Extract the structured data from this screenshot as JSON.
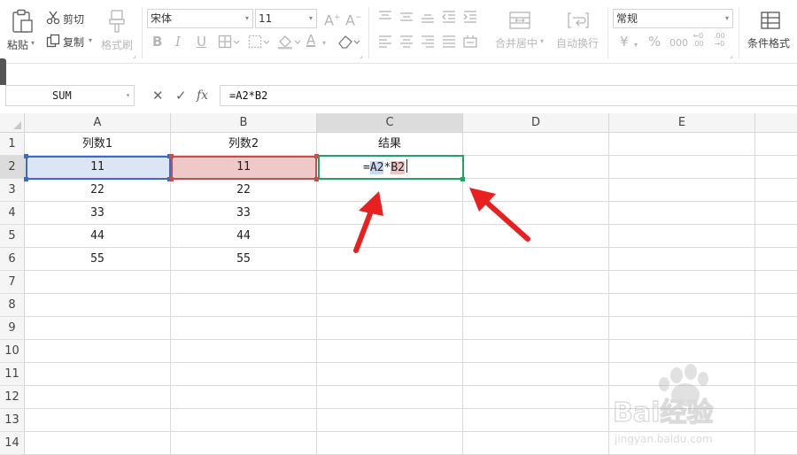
{
  "ribbon": {
    "paste_label": "粘贴",
    "cut_label": "剪切",
    "copy_label": "复制",
    "format_painter_label": "格式刷",
    "font_name": "宋体",
    "font_size": "11",
    "increase_font": "A⁺",
    "decrease_font": "A⁻",
    "bold": "B",
    "italic": "I",
    "underline": "U",
    "merge_center_label": "合并居中",
    "wrap_text_label": "自动换行",
    "number_format": "常规",
    "currency": "¥",
    "percent": "%",
    "thousands": "000",
    "inc_decimal": "←0\n.00",
    "dec_decimal": ".00\n→0",
    "conditional_format_label": "条件格式"
  },
  "formula_bar": {
    "name_box": "SUM",
    "cancel": "✕",
    "confirm": "✓",
    "fx": "fx",
    "content": "=A2*B2"
  },
  "sheet": {
    "columns": [
      "A",
      "B",
      "C",
      "D",
      "E"
    ],
    "rows": [
      "1",
      "2",
      "3",
      "4",
      "5",
      "6",
      "7",
      "8",
      "9",
      "10",
      "11",
      "12",
      "13",
      "14"
    ],
    "cells": {
      "A1": "列数1",
      "B1": "列数2",
      "C1": "结果",
      "A2": "11",
      "B2": "11",
      "A3": "22",
      "B3": "22",
      "A4": "33",
      "B4": "33",
      "A5": "44",
      "B5": "44",
      "A6": "55",
      "B6": "55"
    },
    "editing": {
      "cell": "C2",
      "prefix": "=",
      "ref_a": "A2",
      "operator": "*",
      "ref_b": "B2"
    }
  },
  "colors": {
    "ref_a_fill": "#dbe5f6",
    "ref_a_border": "#3d6bc4",
    "ref_b_fill": "#efc9c9",
    "ref_b_border": "#c0504d",
    "active_border": "#21a366",
    "arrow": "#e8201f"
  },
  "watermark": {
    "brand": "Bai经验",
    "url": "jingyan.baidu.com"
  }
}
